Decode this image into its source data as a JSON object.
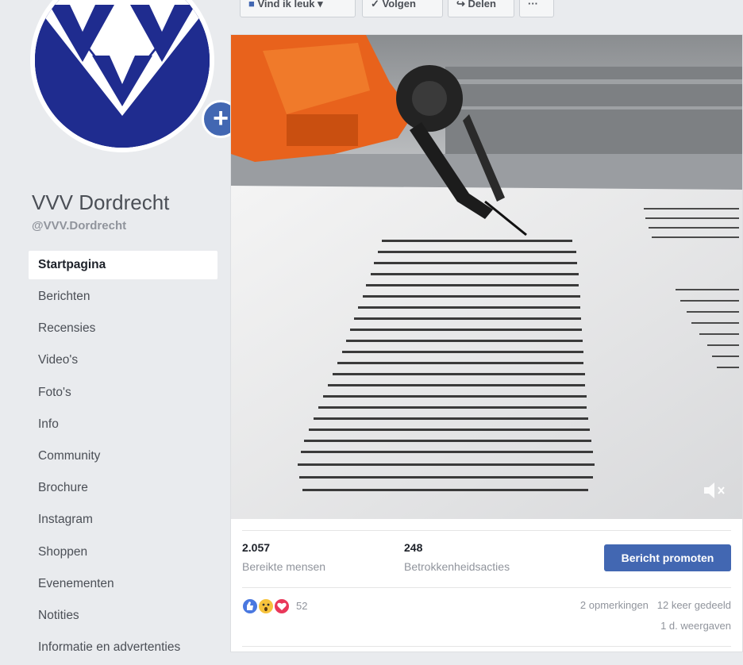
{
  "page": {
    "name": "VVV Dordrecht",
    "handle": "@VVV.Dordrecht"
  },
  "sidebar": {
    "items": [
      {
        "label": "Startpagina",
        "active": true
      },
      {
        "label": "Berichten"
      },
      {
        "label": "Recensies"
      },
      {
        "label": "Video's"
      },
      {
        "label": "Foto's"
      },
      {
        "label": "Info"
      },
      {
        "label": "Community"
      },
      {
        "label": "Brochure"
      },
      {
        "label": "Instagram"
      },
      {
        "label": "Shoppen"
      },
      {
        "label": "Evenementen"
      },
      {
        "label": "Notities"
      },
      {
        "label": "Informatie en advertenties"
      }
    ]
  },
  "toolbar": {
    "like_label": "Vind ik leuk",
    "follow_label": "Volgen",
    "share_label": "Delen",
    "more_label": "···"
  },
  "post": {
    "reached_count": "2.057",
    "reached_label": "Bereikte mensen",
    "engagement_count": "248",
    "engagement_label": "Betrokkenheidsacties",
    "promote_label": "Bericht promoten",
    "reaction_count": "52",
    "comments": "2 opmerkingen",
    "shares": "12 keer gedeeld",
    "views": "1 d. weergaven"
  },
  "colors": {
    "brand_blue": "#1f2c8f",
    "facebook_blue": "#4267b2",
    "robot_orange": "#e8621c"
  },
  "icons": {
    "add_photo": "plus-icon",
    "mute": "speaker-muted-icon",
    "reactions": [
      "like-icon",
      "wow-icon",
      "love-icon"
    ]
  }
}
